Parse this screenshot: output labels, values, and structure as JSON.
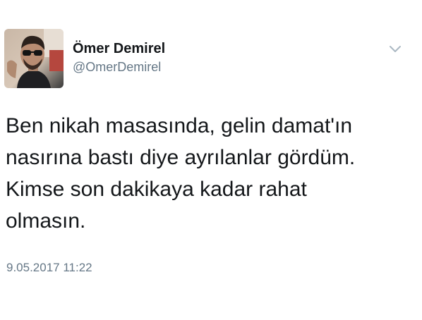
{
  "tweet": {
    "author": {
      "display_name": "Ömer Demirel",
      "handle": "@OmerDemirel",
      "avatar_icon": "profile-photo"
    },
    "menu_icon": "chevron-down-icon",
    "text_lines": [
      "Ben nikah masasında, gelin damat'ın",
      "nasırına bastı diye ayrılanlar gördüm.",
      "Kimse son dakikaya kadar rahat",
      "olmasın."
    ],
    "timestamp": "9.05.2017 11:22"
  },
  "colors": {
    "text_primary": "#14171a",
    "text_secondary": "#657786",
    "chevron": "#aab8c2",
    "background": "#ffffff"
  }
}
